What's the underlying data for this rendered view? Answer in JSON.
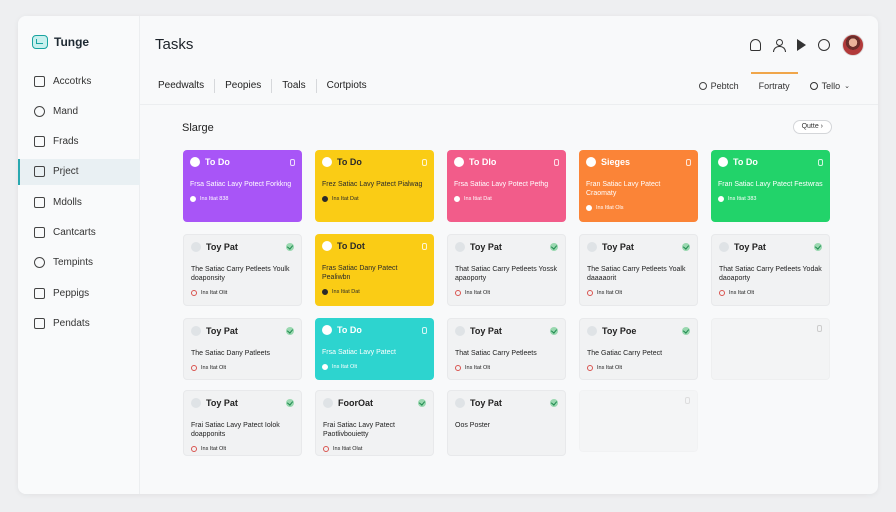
{
  "app": {
    "name": "Tunge"
  },
  "sidebar": {
    "items": [
      {
        "label": "Accotrks",
        "icon": "home-icon"
      },
      {
        "label": "Mand",
        "icon": "person-icon"
      },
      {
        "label": "Frads",
        "icon": "folder-icon"
      },
      {
        "label": "Prject",
        "icon": "project-icon",
        "active": true
      },
      {
        "label": "Mdolls",
        "icon": "grid-icon"
      },
      {
        "label": "Cantcarts",
        "icon": "contacts-icon"
      },
      {
        "label": "Tempints",
        "icon": "clock-icon"
      },
      {
        "label": "Peppigs",
        "icon": "mail-icon"
      },
      {
        "label": "Pendats",
        "icon": "calendar-icon"
      }
    ]
  },
  "header": {
    "title": "Tasks"
  },
  "tabs": [
    "Peedwalts",
    "Peopies",
    "Toals",
    "Cortpiots"
  ],
  "tab_right": {
    "items": [
      {
        "label": "Pebtch",
        "icon": "pin-icon"
      },
      {
        "label": "Fortraty",
        "active": true
      },
      {
        "label": "Tello",
        "icon": "search-icon",
        "has_caret": true
      }
    ]
  },
  "section": {
    "title": "Slarge",
    "filter_label": "Qutte ›"
  },
  "colors": {
    "purple": "#a855f7",
    "yellow": "#facc15",
    "pink": "#f25c8a",
    "orange": "#fb8437",
    "green": "#22d36a",
    "cyan": "#2dd4cf",
    "accent": "#2aa8b0"
  },
  "cards": [
    {
      "col": 0,
      "row": 0,
      "color": "purple",
      "title": "To Do",
      "body": "Frsa Satiac Lavy Potect Forkkng",
      "footer": "Ins Itiat 838"
    },
    {
      "col": 1,
      "row": 0,
      "color": "yellow",
      "title": "To Do",
      "body": "Frez Satiac Lavy Patect Pialwag",
      "footer": "Ins Itat Dat"
    },
    {
      "col": 2,
      "row": 0,
      "color": "pink",
      "title": "To Dlo",
      "body": "Frsa Satiac Lavy Potect Pethg",
      "footer": "Ins Itiat Dat"
    },
    {
      "col": 3,
      "row": 0,
      "color": "orange",
      "title": "Sieges",
      "body": "Fran Satiac Lavy Patect Craomaty",
      "footer": "Ins Itlat Ols"
    },
    {
      "col": 4,
      "row": 0,
      "color": "green",
      "title": "To Do",
      "body": "Fran Satiac Lavy Patect Festwras",
      "footer": "Ins Itiat 383"
    },
    {
      "col": 0,
      "row": 1,
      "color": "",
      "title": "Toy Pat",
      "body": "The Satiac Carry Petleets Youlk doaponsity",
      "footer": "Ins Itat Olit"
    },
    {
      "col": 1,
      "row": 1,
      "color": "yellow",
      "title": "To Dot",
      "body": "Fras Satiac Dany Patect Pealiwbn",
      "footer": "Ins Itiat Dat"
    },
    {
      "col": 2,
      "row": 1,
      "color": "",
      "title": "Toy Pat",
      "body": "That Satiac Carry Petleets Yossk apaoporty",
      "footer": "Ins Itat Olt"
    },
    {
      "col": 3,
      "row": 1,
      "color": "",
      "title": "Toy Pat",
      "body": "The Satiac Carry Petleets Yoalk daaaaorit",
      "footer": "Ins Itat Olt"
    },
    {
      "col": 4,
      "row": 1,
      "color": "",
      "title": "Toy Pat",
      "body": "That Satiac Carry Petleets Yodak daoaporty",
      "footer": "Ins Itat Olt"
    },
    {
      "col": 0,
      "row": 2,
      "color": "",
      "title": "Toy Pat",
      "body": "The Satiac Dany Patleets",
      "footer": "Ins Itat Olt"
    },
    {
      "col": 1,
      "row": 2,
      "color": "cyan",
      "title": "To Do",
      "body": "Frsa Satiac Lavy Patect",
      "footer": "Ins Itat Olt"
    },
    {
      "col": 2,
      "row": 2,
      "color": "",
      "title": "Toy Pat",
      "body": "That Satiac Carry Petleets",
      "footer": "Ins Itat Olt"
    },
    {
      "col": 3,
      "row": 2,
      "color": "",
      "title": "Toy Poe",
      "body": "The Gatiac Carry Petect",
      "footer": "Ins Itat Olt"
    },
    {
      "col": 0,
      "row": 3,
      "color": "",
      "title": "Toy Pat",
      "body": "Frai Satiac Lavy Patect Iolok doapponits",
      "footer": "Ins Itat Olt"
    },
    {
      "col": 1,
      "row": 3,
      "color": "",
      "title": "FoorOat",
      "body": "Frai Satiac Lavy Patect Paotlivbouietty",
      "footer": "Ins Itiat Olat"
    },
    {
      "col": 2,
      "row": 3,
      "color": "",
      "title": "Toy Pat",
      "body": "Oos Poster",
      "footer": ""
    }
  ]
}
